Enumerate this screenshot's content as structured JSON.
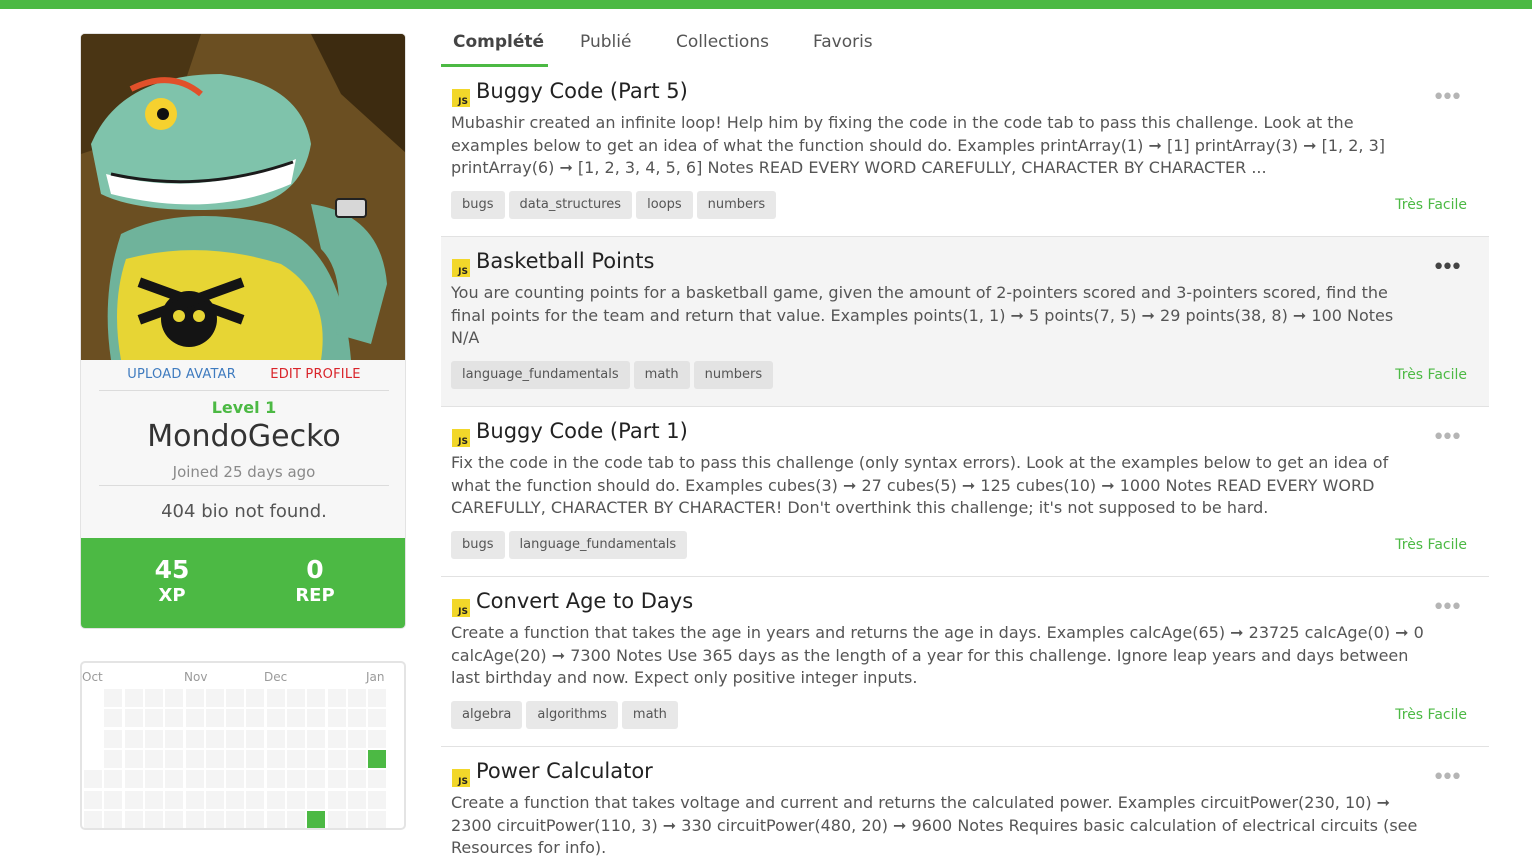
{
  "profile": {
    "upload_avatar": "UPLOAD AVATAR",
    "edit_profile": "EDIT PROFILE",
    "level": "Level 1",
    "username": "MondoGecko",
    "joined": "Joined 25 days ago",
    "bio": "404 bio not found.",
    "xp_value": "45",
    "xp_label": "XP",
    "rep_value": "0",
    "rep_label": "REP"
  },
  "activity": {
    "months": [
      "Oct",
      "Nov",
      "Dec",
      "Jan"
    ],
    "active_color": "#4cb944"
  },
  "tabs": [
    {
      "label": "Complété",
      "active": true
    },
    {
      "label": "Publié",
      "active": false
    },
    {
      "label": "Collections",
      "active": false
    },
    {
      "label": "Favoris",
      "active": false
    }
  ],
  "challenges": [
    {
      "lang_badge": "JS",
      "title": "Buggy Code (Part 5)",
      "description": "Mubashir created an infinite loop! Help him by fixing the code in the code tab to pass this challenge. Look at the examples below to get an idea of what the function should do. Examples printArray(1) ➞ [1] printArray(3) ➞ [1, 2, 3] printArray(6) ➞ [1, 2, 3, 4, 5, 6] Notes READ EVERY WORD CAREFULLY, CHARACTER BY CHARACTER ...",
      "tags": [
        "bugs",
        "data_structures",
        "loops",
        "numbers"
      ],
      "difficulty": "Très Facile",
      "menu": "•••"
    },
    {
      "lang_badge": "JS",
      "title": "Basketball Points",
      "description": "You are counting points for a basketball game, given the amount of 2-pointers scored and 3-pointers scored, find the final points for the team and return that value. Examples points(1, 1) ➞ 5 points(7, 5) ➞ 29 points(38, 8) ➞ 100 Notes N/A",
      "tags": [
        "language_fundamentals",
        "math",
        "numbers"
      ],
      "difficulty": "Très Facile",
      "menu": "•••"
    },
    {
      "lang_badge": "JS",
      "title": "Buggy Code (Part 1)",
      "description": "Fix the code in the code tab to pass this challenge (only syntax errors). Look at the examples below to get an idea of what the function should do. Examples cubes(3) ➞ 27 cubes(5) ➞ 125 cubes(10) ➞ 1000 Notes READ EVERY WORD CAREFULLY, CHARACTER BY CHARACTER! Don't overthink this challenge; it's not supposed to be hard.",
      "tags": [
        "bugs",
        "language_fundamentals"
      ],
      "difficulty": "Très Facile",
      "menu": "•••"
    },
    {
      "lang_badge": "JS",
      "title": "Convert Age to Days",
      "description": "Create a function that takes the age in years and returns the age in days. Examples calcAge(65) ➞ 23725 calcAge(0) ➞ 0 calcAge(20) ➞ 7300 Notes Use 365 days as the length of a year for this challenge. Ignore leap years and days between last birthday and now. Expect only positive integer inputs.",
      "tags": [
        "algebra",
        "algorithms",
        "math"
      ],
      "difficulty": "Très Facile",
      "menu": "•••"
    },
    {
      "lang_badge": "JS",
      "title": "Power Calculator",
      "description": "Create a function that takes voltage and current and returns the calculated power. Examples circuitPower(230, 10) ➞ 2300 circuitPower(110, 3) ➞ 330 circuitPower(480, 20) ➞ 9600 Notes Requires basic calculation of electrical circuits (see Resources for info).",
      "tags": [],
      "difficulty": "",
      "menu": "•••"
    }
  ]
}
